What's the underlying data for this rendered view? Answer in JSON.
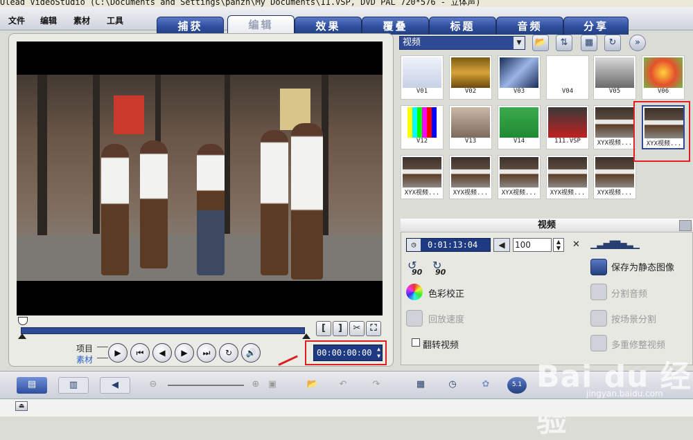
{
  "title": "Ulead VideoStudio (C:\\Documents and Settings\\panzh\\My Documents\\11.VSP, DVD PAL 720*576 - 立体声)",
  "menu": [
    "文件",
    "编辑",
    "素材",
    "工具"
  ],
  "tabs": [
    {
      "label": "捕获",
      "active": false
    },
    {
      "label": "编辑",
      "active": true
    },
    {
      "label": "效果",
      "active": false
    },
    {
      "label": "覆叠",
      "active": false
    },
    {
      "label": "标题",
      "active": false
    },
    {
      "label": "音频",
      "active": false
    },
    {
      "label": "分享",
      "active": false
    }
  ],
  "player": {
    "mode_project": "项目",
    "mode_clip": "素材",
    "timecode": "00:00:00:00",
    "mark_in": "[",
    "mark_out": "]"
  },
  "library": {
    "category": "视频",
    "thumbnails": [
      "V01",
      "V02",
      "V03",
      "V04",
      "V05",
      "V06",
      "V12",
      "V13",
      "V14",
      "111.VSP",
      "XYX视频...",
      "XYX视频...",
      "XYX视频...",
      "XYX视频...",
      "XYX视频...",
      "XYX视频...",
      "XYX视频..."
    ]
  },
  "options": {
    "header": "视频",
    "duration": "0:01:13:04",
    "volume": "100",
    "rotate_left": "90",
    "rotate_right": "90",
    "color_correction": "色彩校正",
    "playback_speed": "回放速度",
    "reverse_video": "翻转视频",
    "save_still": "保存为静态图像",
    "split_audio": "分割音频",
    "split_by_scene": "按场景分割",
    "multi_trim": "多重修整视频"
  },
  "watermark": {
    "brand": "Bai du 经验",
    "url": "jingyan.baidu.com"
  },
  "colors": {
    "tab_blue": "#2f4f9e",
    "highlight_red": "#e01e1e",
    "timecode_bg": "#1d3a82"
  }
}
